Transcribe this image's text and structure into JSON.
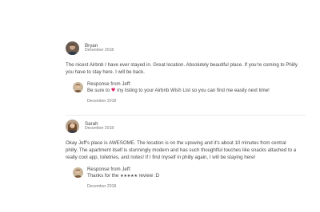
{
  "reviews": [
    {
      "name": "Bryan",
      "date": "December 2018",
      "text": "The nicest Airbnb I have ever stayed in. Great location. Absolutely beautiful place. If you're coming to Philly you have to stay here. I will be back.",
      "response": {
        "title": "Response from Jeff:",
        "text_before": "Be sure to",
        "heart_icon": "heart-icon",
        "text_after": "my listing to your Airbnb Wish List so you can find me easily next time!",
        "date": "December 2018"
      }
    },
    {
      "name": "Sarah",
      "date": "December 2018",
      "text": "Okay Jeff's place is AWESOME. The location is on the upswing and it's about 10 minutes from central philly. The apartment itself is stunningly modern and has such thoughtful touches like snacks attached to a really cool app, toiletries, and notes! If I find myself in philly again, I will be staying here!",
      "response": {
        "title": "Response from Jeff:",
        "text_before": "Thanks for the",
        "stars": "★★★★★",
        "text_after": "review :D",
        "date": "December 2018"
      }
    }
  ],
  "colors": {
    "text": "#484848",
    "muted": "#767676",
    "heart": "#e0245e",
    "divider": "#ebebeb"
  }
}
